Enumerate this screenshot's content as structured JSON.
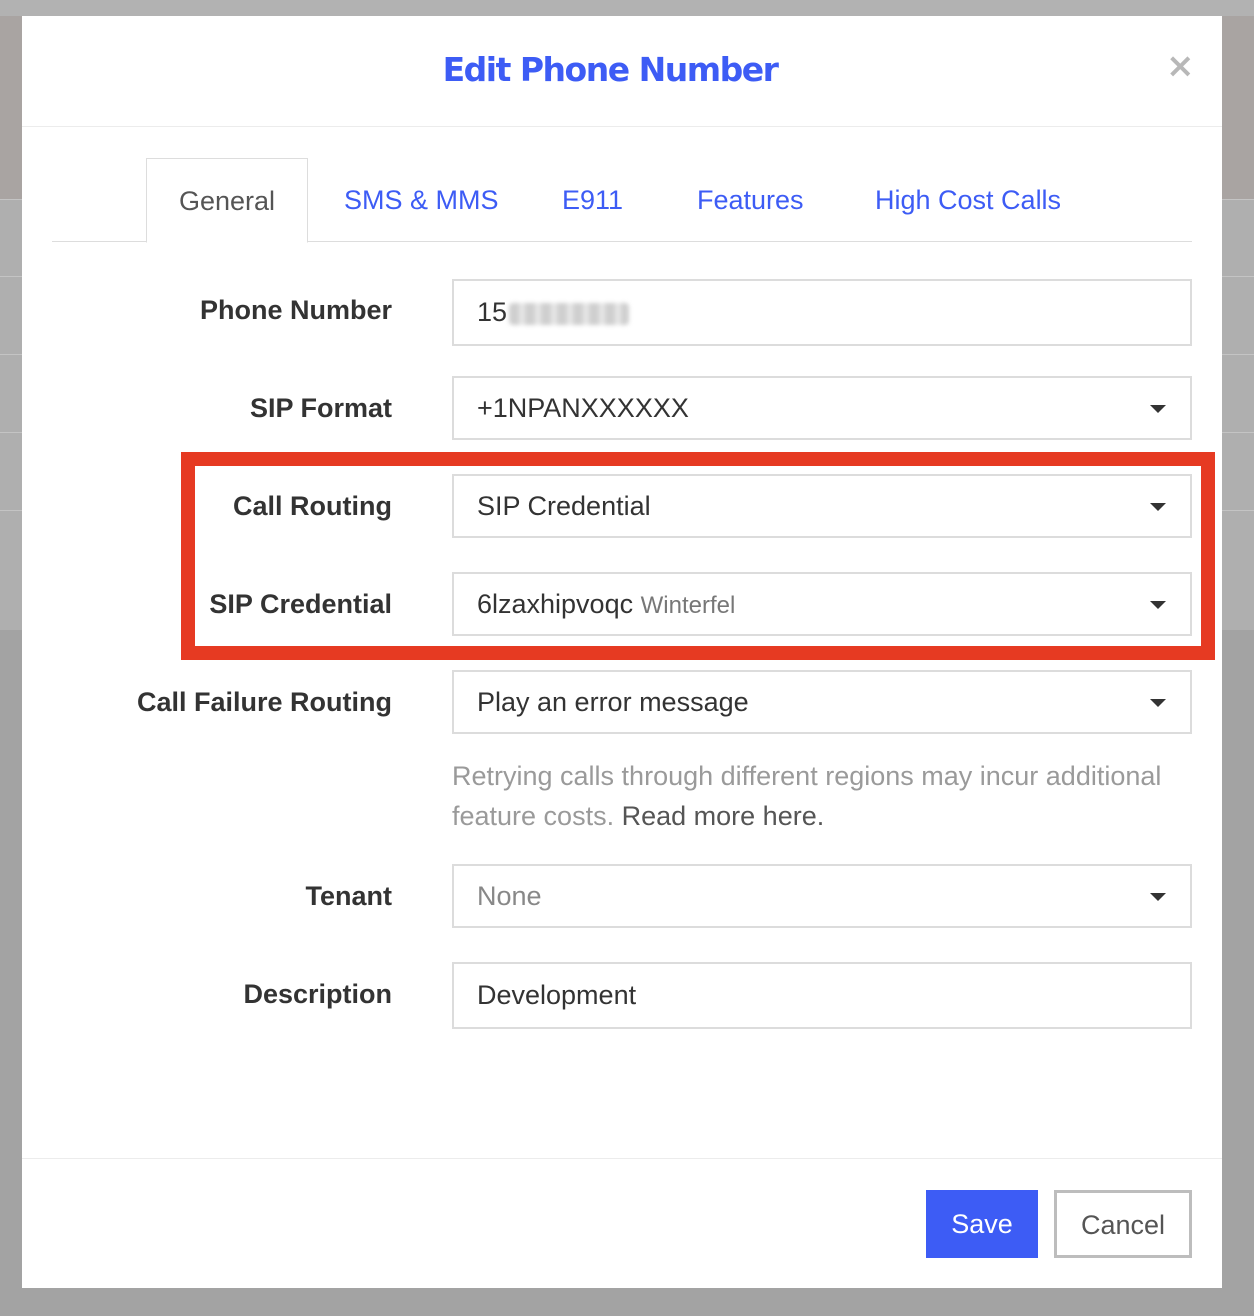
{
  "modal": {
    "title": "Edit Phone Number",
    "close_symbol": "×"
  },
  "tabs": [
    {
      "label": "General",
      "active": true
    },
    {
      "label": "SMS & MMS",
      "active": false
    },
    {
      "label": "E911",
      "active": false
    },
    {
      "label": "Features",
      "active": false
    },
    {
      "label": "High Cost Calls",
      "active": false
    }
  ],
  "form": {
    "phone_number": {
      "label": "Phone Number",
      "value_visible": "15"
    },
    "sip_format": {
      "label": "SIP Format",
      "value": "+1NPANXXXXXX"
    },
    "call_routing": {
      "label": "Call Routing",
      "value": "SIP Credential"
    },
    "sip_credential": {
      "label": "SIP Credential",
      "value": "6lzaxhipvoqc",
      "sub": "Winterfel"
    },
    "call_failure_routing": {
      "label": "Call Failure Routing",
      "value": "Play an error message"
    },
    "help_text": "Retrying calls through different regions may incur additional feature costs.",
    "help_link": "Read more here.",
    "tenant": {
      "label": "Tenant",
      "value": "None"
    },
    "description": {
      "label": "Description",
      "value": "Development"
    }
  },
  "footer": {
    "save_label": "Save",
    "cancel_label": "Cancel"
  },
  "colors": {
    "accent": "#3d5cf5",
    "highlight": "#e63a22"
  },
  "icons": [
    "close-icon",
    "chevron-down-icon"
  ]
}
